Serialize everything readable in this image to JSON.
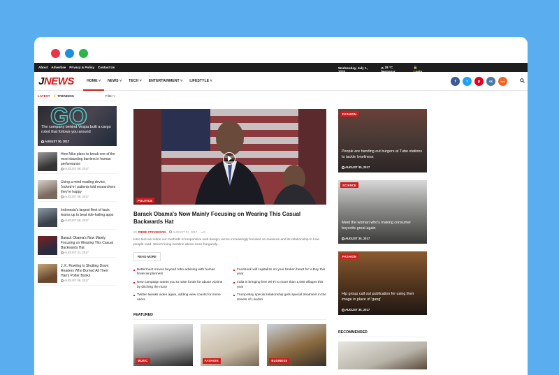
{
  "topbar": {
    "links": [
      "About",
      "Advertise",
      "Privacy & Policy",
      "Contact Us"
    ],
    "date": "Wednesday, July 1, 2020",
    "weather": "28 °C Denpasar",
    "login": "Login"
  },
  "logo": {
    "j": "J",
    "news": "NEWS"
  },
  "nav": {
    "items": [
      {
        "label": "HOME"
      },
      {
        "label": "NEWS"
      },
      {
        "label": "TECH"
      },
      {
        "label": "ENTERTAINMENT"
      },
      {
        "label": "LIFESTYLE"
      }
    ]
  },
  "social": [
    {
      "letter": "f",
      "icon": "facebook-icon",
      "color": "#3b5998"
    },
    {
      "letter": "t",
      "icon": "twitter-icon",
      "color": "#1da1f2"
    },
    {
      "letter": "p",
      "icon": "pinterest-icon",
      "color": "#e60023"
    },
    {
      "letter": "vk",
      "icon": "vk-icon",
      "color": "#4a76a8"
    },
    {
      "letter": "rss",
      "icon": "rss-icon",
      "color": "#f26522"
    }
  ],
  "sidebar": {
    "tab_latest": "LATEST",
    "tab_trending": "TRENDING",
    "filter": "Filter",
    "hero": {
      "title": "The company behind Vespa built a cargo robot that follows you around",
      "date": "AUGUST 30, 2017"
    },
    "items": [
      {
        "title": "How Nike plans to break one of the most daunting barriers in human performance",
        "date": "AUGUST 08, 2017"
      },
      {
        "title": "Using a mind reading device, 'locked-in' patients told researchers they're happy",
        "date": "AUGUST 08, 2017"
      },
      {
        "title": "Indonesia's largest fleet of taxis teams up to beat ride-hailing apps",
        "date": "AUGUST 08, 2017"
      },
      {
        "title": "Barack Obama's Now Mainly Focusing on Wearing This Casual Backwards Hat",
        "date": "AUGUST 31, 2017"
      },
      {
        "title": "J. K. Rowling Is Shutting Down Readers Who Burned All Their Harry Potter Books",
        "date": "AUGUST 08, 2017"
      }
    ]
  },
  "main": {
    "category": "POLITICS",
    "title": "Barack Obama's Now Mainly Focusing on Wearing This Casual Backwards Hat",
    "by": "BY",
    "author": "PIERE STEVENSON",
    "date": "AUGUST 31, 2017",
    "comments": "0",
    "excerpt": "Intro text we refine our methods of responsive web design, we've increasingly focused on measure and its relationship to how people read. Strech lining hemline above knee burgundy...",
    "read_more": "READ MORE",
    "bullets": [
      "Betterment moves beyond robo-advising with human financial planners",
      "Facebook will capitalize on your broken heart for V-Day this year",
      "New campaign wants you to raise funds for abuse victims by ditching the razor",
      "India is bringing free Wi-Fi to more than 1,000 villages this year",
      "Twitter tweaks video again, adding view counts for some users",
      "Trump-May special relationship gets special treatment in the streets of London"
    ],
    "featured_heading": "FEATURED",
    "featured": [
      {
        "category": "MUSIC"
      },
      {
        "category": "FASHION"
      },
      {
        "category": "BUSINESS"
      }
    ]
  },
  "right": {
    "cards": [
      {
        "category": "FASHION",
        "title": "People are handing out burgers at Tube stations to tackle loneliness",
        "date": "AUGUST 30, 2017"
      },
      {
        "category": "SCIENCE",
        "title": "Meet the woman who's making consumer boycotts great again",
        "date": "AUGUST 30, 2017"
      },
      {
        "category": "FASHION",
        "title": "Hip group call out publication for using their image in place of 'gang'",
        "date": "AUGUST 30, 2017"
      }
    ],
    "recommended_heading": "RECOMMENDED"
  }
}
